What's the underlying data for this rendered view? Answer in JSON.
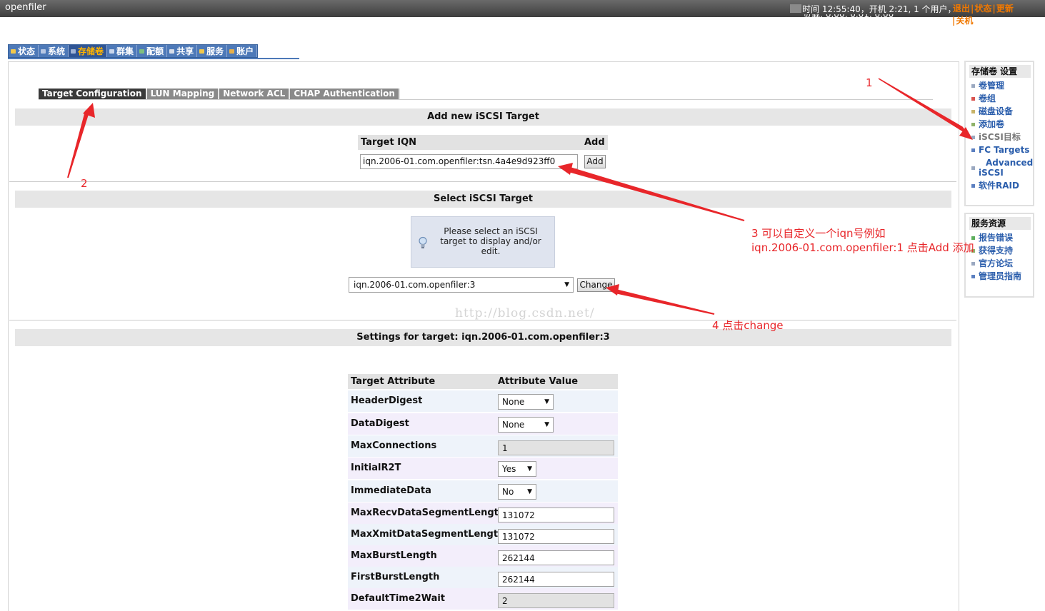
{
  "app": {
    "logo": "openfiler",
    "status_line": "时间 12:55:40，开机 2:21, 1 个用户，",
    "status_line2": "负载: 0.00, 0.01, 0.00",
    "links": {
      "logout": "退出",
      "status": "状态",
      "update": "更新",
      "shutdown": "关机"
    }
  },
  "main_tabs": [
    "状态",
    "系统",
    "存储卷",
    "群集",
    "配额",
    "共享",
    "服务",
    "账户"
  ],
  "sub_tabs": [
    "Target Configuration",
    "LUN Mapping",
    "Network ACL",
    "CHAP Authentication"
  ],
  "add_section": {
    "title": "Add new iSCSI Target",
    "col_iqn": "Target IQN",
    "col_add": "Add",
    "iqn_value": "iqn.2006-01.com.openfiler:tsn.4a4e9d923ff0",
    "add_button": "Add"
  },
  "select_section": {
    "title": "Select iSCSI Target",
    "info": "Please select an iSCSI target to display and/or edit.",
    "selected": "iqn.2006-01.com.openfiler:3",
    "change_button": "Change"
  },
  "watermark": "http://blog.csdn.net/",
  "settings_section": {
    "title": "Settings for target: iqn.2006-01.com.openfiler:3",
    "col_attr": "Target Attribute",
    "col_value": "Attribute Value",
    "rows": [
      {
        "name": "HeaderDigest",
        "value": "None",
        "kind": "select"
      },
      {
        "name": "DataDigest",
        "value": "None",
        "kind": "select"
      },
      {
        "name": "MaxConnections",
        "value": "1",
        "kind": "readonly"
      },
      {
        "name": "InitialR2T",
        "value": "Yes",
        "kind": "select"
      },
      {
        "name": "ImmediateData",
        "value": "No",
        "kind": "select"
      },
      {
        "name": "MaxRecvDataSegmentLength",
        "value": "131072",
        "kind": "input"
      },
      {
        "name": "MaxXmitDataSegmentLength",
        "value": "131072",
        "kind": "input"
      },
      {
        "name": "MaxBurstLength",
        "value": "262144",
        "kind": "input"
      },
      {
        "name": "FirstBurstLength",
        "value": "262144",
        "kind": "input"
      },
      {
        "name": "DefaultTime2Wait",
        "value": "2",
        "kind": "readonly"
      }
    ]
  },
  "sidebar_volume": {
    "title": "存储卷 设置",
    "items": [
      "卷管理",
      "卷组",
      "磁盘设备",
      "添加卷",
      "iSCSI目标",
      "FC Targets",
      "Advanced iSCSI",
      "软件RAID"
    ]
  },
  "sidebar_support": {
    "title": "服务资源",
    "items": [
      "报告错误",
      "获得支持",
      "官方论坛",
      "管理员指南"
    ]
  },
  "annotations": {
    "a1": "1",
    "a2": "2",
    "a3_line1": "3 可以自定义一个iqn号例如",
    "a3_line2": "iqn.2006-01.com.openfiler:1 点击Add 添加",
    "a4": "4  点击change"
  },
  "colors": {
    "accent_orange": "#f07800",
    "tab_blue": "#4d79b8",
    "link_blue": "#2b5eac",
    "annotation_red": "#e8262a"
  }
}
